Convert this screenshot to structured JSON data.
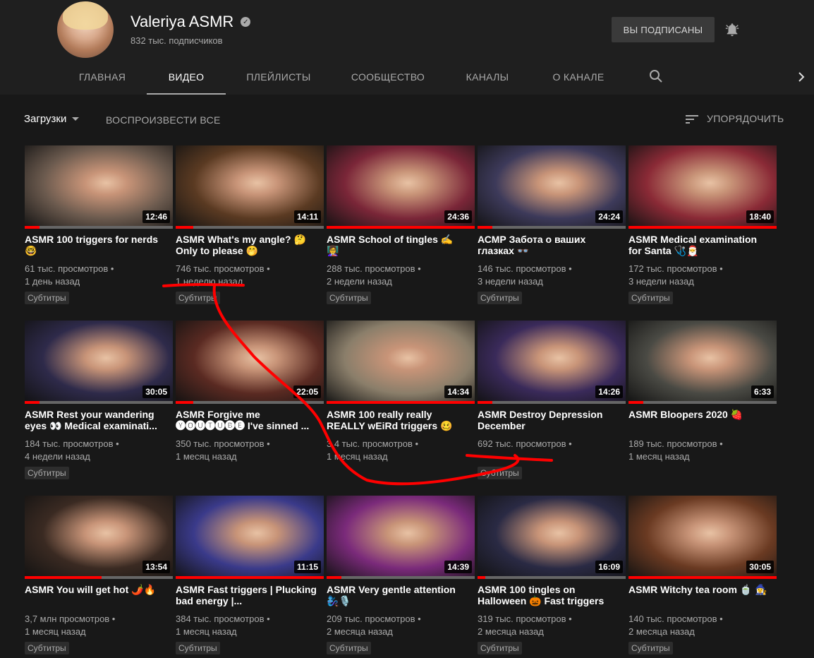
{
  "channel": {
    "name": "Valeriya ASMR",
    "subscribers": "832 тыс. подписчиков",
    "subscribed_label": "ВЫ ПОДПИСАНЫ"
  },
  "tabs": [
    {
      "label": "ГЛАВНАЯ",
      "active": false
    },
    {
      "label": "ВИДЕО",
      "active": true
    },
    {
      "label": "ПЛЕЙЛИСТЫ",
      "active": false
    },
    {
      "label": "СООБЩЕСТВО",
      "active": false
    },
    {
      "label": "КАНАЛЫ",
      "active": false
    },
    {
      "label": "О КАНАЛЕ",
      "active": false
    }
  ],
  "toolbar": {
    "uploads_label": "Загрузки",
    "play_all_label": "ВОСПРОИЗВЕСТИ ВСЕ",
    "sort_label": "УПОРЯДОЧИТЬ"
  },
  "colors": {
    "background": "#181818",
    "header": "#1f1f1f",
    "progress": "#ff0000",
    "annotation": "#ff0000"
  },
  "videos": [
    {
      "title": "ASMR 100 triggers for nerds 🤓",
      "duration": "12:46",
      "views": "61 тыс. просмотров •",
      "age": "1 день назад",
      "badge": "Субтитры",
      "progress": 0.1,
      "hue": "#6b5a4e"
    },
    {
      "title": "ASMR What's my angle? 🤔 Only to please 🤭",
      "duration": "14:11",
      "views": "746 тыс. просмотров •",
      "age": "1 неделю назад",
      "badge": "Субтитры",
      "progress": 0.12,
      "hue": "#5a3a22"
    },
    {
      "title": "ASMR School of tingles ✍️ 👩‍🏫",
      "duration": "24:36",
      "views": "288 тыс. просмотров •",
      "age": "2 недели назад",
      "badge": "Субтитры",
      "progress": 1.0,
      "hue": "#7a2638"
    },
    {
      "title": "АСМР Забота о ваших глазках 👓",
      "duration": "24:24",
      "views": "146 тыс. просмотров •",
      "age": "3 недели назад",
      "badge": "Субтитры",
      "progress": 0.1,
      "hue": "#3d3a5a"
    },
    {
      "title": "ASMR Medical examination for Santa 🩺🎅",
      "duration": "18:40",
      "views": "172 тыс. просмотров •",
      "age": "3 недели назад",
      "badge": "Субтитры",
      "progress": 1.0,
      "hue": "#8a2a36"
    },
    {
      "title": "ASMR Rest your wandering eyes 👀 Medical examinati...",
      "duration": "30:05",
      "views": "184 тыс. просмотров •",
      "age": "4 недели назад",
      "badge": "Субтитры",
      "progress": 0.1,
      "hue": "#2e2a4a"
    },
    {
      "title": "ASMR Forgive me 🅨🅞🅤🅣🅤🅑🅔 I've sinned ...",
      "duration": "22:05",
      "views": "350 тыс. просмотров •",
      "age": "1 месяц назад",
      "badge": "",
      "progress": 0.12,
      "hue": "#5a2a22"
    },
    {
      "title": "ASMR 100 really really REALLY wEiRd triggers 🥴",
      "duration": "14:34",
      "views": "3 4 тыс. просмотров •",
      "age": "1 месяц назад",
      "badge": "",
      "progress": 1.0,
      "hue": "#8a7e6a"
    },
    {
      "title": "ASMR Destroy Depression December",
      "duration": "14:26",
      "views": "692 тыс. просмотров •",
      "age": "",
      "badge": "Субтитры",
      "progress": 0.1,
      "hue": "#3a2a5a"
    },
    {
      "title": "ASMR Bloopers 2020 🍓",
      "duration": "6:33",
      "views": "189 тыс. просмотров •",
      "age": "1 месяц назад",
      "badge": "",
      "progress": 0.1,
      "hue": "#4a4a44"
    },
    {
      "title": "ASMR You will get hot 🌶️🔥",
      "duration": "13:54",
      "views": "3,7 млн просмотров •",
      "age": "1 месяц назад",
      "badge": "Субтитры",
      "progress": 0.52,
      "hue": "#3a2a22"
    },
    {
      "title": "ASMR Fast triggers | Plucking bad energy |...",
      "duration": "11:15",
      "views": "384 тыс. просмотров •",
      "age": "1 месяц назад",
      "badge": "Субтитры",
      "progress": 1.0,
      "hue": "#3a3a8a"
    },
    {
      "title": "ASMR Very gentle attention 🧞‍♀️🎙️",
      "duration": "14:39",
      "views": "209 тыс. просмотров •",
      "age": "2 месяца назад",
      "badge": "Субтитры",
      "progress": 0.1,
      "hue": "#7a2a7a"
    },
    {
      "title": "ASMR 100 tingles on Halloween 🎃 Fast triggers",
      "duration": "16:09",
      "views": "319 тыс. просмотров •",
      "age": "2 месяца назад",
      "badge": "Субтитры",
      "progress": 0.05,
      "hue": "#2a2a44"
    },
    {
      "title": "ASMR Witchy tea room 🍵 🧙‍♀️",
      "duration": "30:05",
      "views": "140 тыс. просмотров •",
      "age": "2 месяца назад",
      "badge": "Субтитры",
      "progress": 1.0,
      "hue": "#6a3a22"
    }
  ]
}
